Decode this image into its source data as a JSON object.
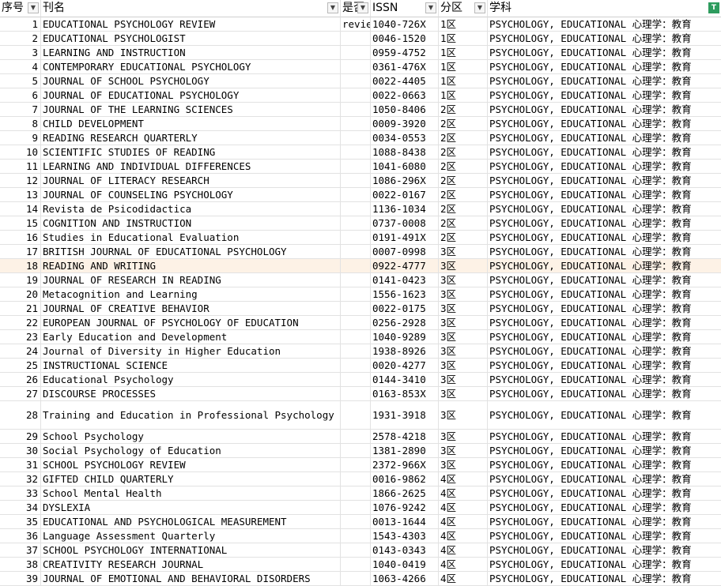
{
  "sheet": {
    "headers": [
      {
        "label": "序号",
        "filter": "▼"
      },
      {
        "label": "刊名",
        "filter": "▼"
      },
      {
        "label": "是否",
        "filter": "▼"
      },
      {
        "label": "ISSN",
        "filter": "▼"
      },
      {
        "label": "分区",
        "filter": "▼"
      },
      {
        "label": "学科",
        "filter": "T"
      }
    ],
    "rows": [
      {
        "no": "1",
        "name": "EDUCATIONAL PSYCHOLOGY REVIEW",
        "flag": "revie",
        "issn": "1040-726X",
        "zone": "1区",
        "subject": "PSYCHOLOGY, EDUCATIONAL 心理学：教育"
      },
      {
        "no": "2",
        "name": "EDUCATIONAL PSYCHOLOGIST",
        "flag": "",
        "issn": "0046-1520",
        "zone": "1区",
        "subject": "PSYCHOLOGY, EDUCATIONAL 心理学：教育"
      },
      {
        "no": "3",
        "name": "LEARNING AND INSTRUCTION",
        "flag": "",
        "issn": "0959-4752",
        "zone": "1区",
        "subject": "PSYCHOLOGY, EDUCATIONAL 心理学：教育"
      },
      {
        "no": "4",
        "name": "CONTEMPORARY EDUCATIONAL PSYCHOLOGY",
        "flag": "",
        "issn": "0361-476X",
        "zone": "1区",
        "subject": "PSYCHOLOGY, EDUCATIONAL 心理学：教育"
      },
      {
        "no": "5",
        "name": "JOURNAL OF SCHOOL PSYCHOLOGY",
        "flag": "",
        "issn": "0022-4405",
        "zone": "1区",
        "subject": "PSYCHOLOGY, EDUCATIONAL 心理学：教育"
      },
      {
        "no": "6",
        "name": "JOURNAL OF EDUCATIONAL PSYCHOLOGY",
        "flag": "",
        "issn": "0022-0663",
        "zone": "1区",
        "subject": "PSYCHOLOGY, EDUCATIONAL 心理学：教育"
      },
      {
        "no": "7",
        "name": "JOURNAL OF THE LEARNING SCIENCES",
        "flag": "",
        "issn": "1050-8406",
        "zone": "2区",
        "subject": "PSYCHOLOGY, EDUCATIONAL 心理学：教育"
      },
      {
        "no": "8",
        "name": "CHILD DEVELOPMENT",
        "flag": "",
        "issn": "0009-3920",
        "zone": "2区",
        "subject": "PSYCHOLOGY, EDUCATIONAL 心理学：教育"
      },
      {
        "no": "9",
        "name": "READING RESEARCH QUARTERLY",
        "flag": "",
        "issn": "0034-0553",
        "zone": "2区",
        "subject": "PSYCHOLOGY, EDUCATIONAL 心理学：教育"
      },
      {
        "no": "10",
        "name": "SCIENTIFIC STUDIES OF READING",
        "flag": "",
        "issn": "1088-8438",
        "zone": "2区",
        "subject": "PSYCHOLOGY, EDUCATIONAL 心理学：教育"
      },
      {
        "no": "11",
        "name": "LEARNING AND INDIVIDUAL DIFFERENCES",
        "flag": "",
        "issn": "1041-6080",
        "zone": "2区",
        "subject": "PSYCHOLOGY, EDUCATIONAL 心理学：教育"
      },
      {
        "no": "12",
        "name": "JOURNAL OF LITERACY RESEARCH",
        "flag": "",
        "issn": "1086-296X",
        "zone": "2区",
        "subject": "PSYCHOLOGY, EDUCATIONAL 心理学：教育"
      },
      {
        "no": "13",
        "name": "JOURNAL OF COUNSELING PSYCHOLOGY",
        "flag": "",
        "issn": "0022-0167",
        "zone": "2区",
        "subject": "PSYCHOLOGY, EDUCATIONAL 心理学：教育"
      },
      {
        "no": "14",
        "name": "Revista de Psicodidactica",
        "flag": "",
        "issn": "1136-1034",
        "zone": "2区",
        "subject": "PSYCHOLOGY, EDUCATIONAL 心理学：教育"
      },
      {
        "no": "15",
        "name": "COGNITION AND INSTRUCTION",
        "flag": "",
        "issn": "0737-0008",
        "zone": "2区",
        "subject": "PSYCHOLOGY, EDUCATIONAL 心理学：教育"
      },
      {
        "no": "16",
        "name": "Studies in Educational Evaluation",
        "flag": "",
        "issn": "0191-491X",
        "zone": "2区",
        "subject": "PSYCHOLOGY, EDUCATIONAL 心理学：教育"
      },
      {
        "no": "17",
        "name": "BRITISH JOURNAL OF EDUCATIONAL PSYCHOLOGY",
        "flag": "",
        "issn": "0007-0998",
        "zone": "3区",
        "subject": "PSYCHOLOGY, EDUCATIONAL 心理学：教育"
      },
      {
        "no": "18",
        "name": "READING AND WRITING",
        "flag": "",
        "issn": "0922-4777",
        "zone": "3区",
        "subject": "PSYCHOLOGY, EDUCATIONAL 心理学：教育",
        "highlight": true
      },
      {
        "no": "19",
        "name": "JOURNAL OF RESEARCH IN READING",
        "flag": "",
        "issn": "0141-0423",
        "zone": "3区",
        "subject": "PSYCHOLOGY, EDUCATIONAL 心理学：教育"
      },
      {
        "no": "20",
        "name": "Metacognition and Learning",
        "flag": "",
        "issn": "1556-1623",
        "zone": "3区",
        "subject": "PSYCHOLOGY, EDUCATIONAL 心理学：教育"
      },
      {
        "no": "21",
        "name": "JOURNAL OF CREATIVE BEHAVIOR",
        "flag": "",
        "issn": "0022-0175",
        "zone": "3区",
        "subject": "PSYCHOLOGY, EDUCATIONAL 心理学：教育"
      },
      {
        "no": "22",
        "name": "EUROPEAN JOURNAL OF PSYCHOLOGY OF EDUCATION",
        "flag": "",
        "issn": "0256-2928",
        "zone": "3区",
        "subject": "PSYCHOLOGY, EDUCATIONAL 心理学：教育"
      },
      {
        "no": "23",
        "name": "Early Education and Development",
        "flag": "",
        "issn": "1040-9289",
        "zone": "3区",
        "subject": "PSYCHOLOGY, EDUCATIONAL 心理学：教育"
      },
      {
        "no": "24",
        "name": "Journal of Diversity in Higher Education",
        "flag": "",
        "issn": "1938-8926",
        "zone": "3区",
        "subject": "PSYCHOLOGY, EDUCATIONAL 心理学：教育"
      },
      {
        "no": "25",
        "name": "INSTRUCTIONAL SCIENCE",
        "flag": "",
        "issn": "0020-4277",
        "zone": "3区",
        "subject": "PSYCHOLOGY, EDUCATIONAL 心理学：教育"
      },
      {
        "no": "26",
        "name": "Educational Psychology",
        "flag": "",
        "issn": "0144-3410",
        "zone": "3区",
        "subject": "PSYCHOLOGY, EDUCATIONAL 心理学：教育"
      },
      {
        "no": "27",
        "name": "DISCOURSE PROCESSES",
        "flag": "",
        "issn": "0163-853X",
        "zone": "3区",
        "subject": "PSYCHOLOGY, EDUCATIONAL 心理学：教育"
      },
      {
        "no": "28",
        "name": "Training and Education in Professional Psychology",
        "flag": "",
        "issn": "1931-3918",
        "zone": "3区",
        "subject": "PSYCHOLOGY, EDUCATIONAL 心理学：教育",
        "tall": true
      },
      {
        "no": "29",
        "name": "School Psychology",
        "flag": "",
        "issn": "2578-4218",
        "zone": "3区",
        "subject": "PSYCHOLOGY, EDUCATIONAL 心理学：教育"
      },
      {
        "no": "30",
        "name": "Social Psychology of Education",
        "flag": "",
        "issn": "1381-2890",
        "zone": "3区",
        "subject": "PSYCHOLOGY, EDUCATIONAL 心理学：教育"
      },
      {
        "no": "31",
        "name": "SCHOOL PSYCHOLOGY REVIEW",
        "flag": "",
        "issn": "2372-966X",
        "zone": "3区",
        "subject": "PSYCHOLOGY, EDUCATIONAL 心理学：教育"
      },
      {
        "no": "32",
        "name": "GIFTED CHILD QUARTERLY",
        "flag": "",
        "issn": "0016-9862",
        "zone": "4区",
        "subject": "PSYCHOLOGY, EDUCATIONAL 心理学：教育"
      },
      {
        "no": "33",
        "name": "School Mental Health",
        "flag": "",
        "issn": "1866-2625",
        "zone": "4区",
        "subject": "PSYCHOLOGY, EDUCATIONAL 心理学：教育"
      },
      {
        "no": "34",
        "name": "DYSLEXIA",
        "flag": "",
        "issn": "1076-9242",
        "zone": "4区",
        "subject": "PSYCHOLOGY, EDUCATIONAL 心理学：教育"
      },
      {
        "no": "35",
        "name": "EDUCATIONAL AND PSYCHOLOGICAL MEASUREMENT",
        "flag": "",
        "issn": "0013-1644",
        "zone": "4区",
        "subject": "PSYCHOLOGY, EDUCATIONAL 心理学：教育"
      },
      {
        "no": "36",
        "name": "Language Assessment Quarterly",
        "flag": "",
        "issn": "1543-4303",
        "zone": "4区",
        "subject": "PSYCHOLOGY, EDUCATIONAL 心理学：教育"
      },
      {
        "no": "37",
        "name": "SCHOOL PSYCHOLOGY INTERNATIONAL",
        "flag": "",
        "issn": "0143-0343",
        "zone": "4区",
        "subject": "PSYCHOLOGY, EDUCATIONAL 心理学：教育"
      },
      {
        "no": "38",
        "name": "CREATIVITY RESEARCH JOURNAL",
        "flag": "",
        "issn": "1040-0419",
        "zone": "4区",
        "subject": "PSYCHOLOGY, EDUCATIONAL 心理学：教育"
      },
      {
        "no": "39",
        "name": "JOURNAL OF EMOTIONAL AND BEHAVIORAL DISORDERS",
        "flag": "",
        "issn": "1063-4266",
        "zone": "4区",
        "subject": "PSYCHOLOGY, EDUCATIONAL 心理学：教育"
      }
    ]
  },
  "colors": {
    "filter_active": "#2e9c5e",
    "highlight_row": "#fdf2e6",
    "grid": "#e2e2e2"
  }
}
